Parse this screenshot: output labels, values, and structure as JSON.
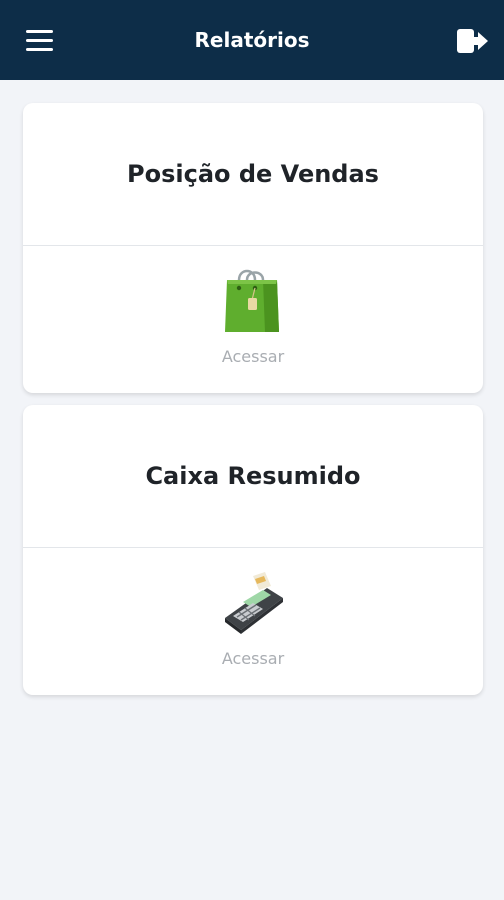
{
  "header": {
    "title": "Relatórios",
    "menu_icon": "hamburger-menu-icon",
    "logout_icon": "logout-icon"
  },
  "cards": [
    {
      "title": "Posição de Vendas",
      "icon": "shopping-bag-icon",
      "action_label": "Acessar"
    },
    {
      "title": "Caixa Resumido",
      "icon": "card-machine-icon",
      "action_label": "Acessar"
    }
  ],
  "colors": {
    "header_bg": "#0d2d48",
    "page_bg": "#f2f4f8",
    "card_bg": "#ffffff",
    "title_text": "#1f2328",
    "link_text": "#a9adb2"
  }
}
